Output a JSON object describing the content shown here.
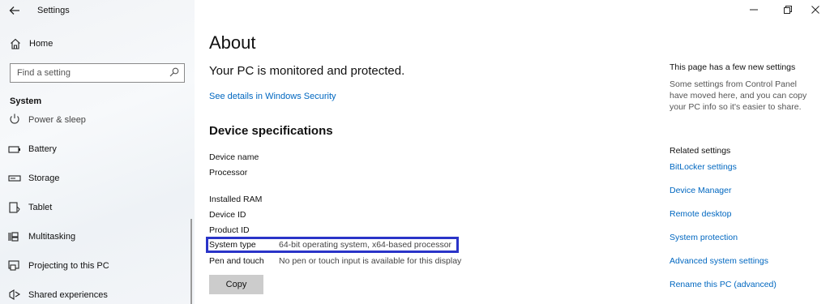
{
  "window": {
    "app_title": "Settings",
    "controls": {
      "minimize": "—",
      "restore": "❐",
      "close": "✕"
    }
  },
  "sidebar": {
    "home_label": "Home",
    "search_placeholder": "Find a setting",
    "section_title": "System",
    "items": [
      {
        "label": "Power & sleep",
        "icon": "power-icon"
      },
      {
        "label": "Battery",
        "icon": "battery-icon"
      },
      {
        "label": "Storage",
        "icon": "storage-icon"
      },
      {
        "label": "Tablet",
        "icon": "tablet-icon"
      },
      {
        "label": "Multitasking",
        "icon": "multitasking-icon"
      },
      {
        "label": "Projecting to this PC",
        "icon": "projecting-icon"
      },
      {
        "label": "Shared experiences",
        "icon": "shared-experiences-icon"
      }
    ]
  },
  "main": {
    "title": "About",
    "protection_message": "Your PC is monitored and protected.",
    "security_link": "See details in Windows Security",
    "spec_heading": "Device specifications",
    "specs": [
      {
        "key": "Device name",
        "value": ""
      },
      {
        "key": "Processor",
        "value": ""
      },
      {
        "key": "Installed RAM",
        "value": ""
      },
      {
        "key": "Device ID",
        "value": ""
      },
      {
        "key": "Product ID",
        "value": ""
      },
      {
        "key": "System type",
        "value": "64-bit operating system, x64-based processor"
      },
      {
        "key": "Pen and touch",
        "value": "No pen or touch input is available for this display"
      }
    ],
    "copy_button": "Copy",
    "highlight_color": "#2a34c8"
  },
  "right": {
    "new_settings_title": "This page has a few new settings",
    "new_settings_desc": "Some settings from Control Panel have moved here, and you can copy your PC info so it's easier to share.",
    "related_title": "Related settings",
    "related_links": [
      "BitLocker settings",
      "Device Manager",
      "Remote desktop",
      "System protection",
      "Advanced system settings",
      "Rename this PC (advanced)"
    ],
    "link_color": "#0067c0"
  }
}
